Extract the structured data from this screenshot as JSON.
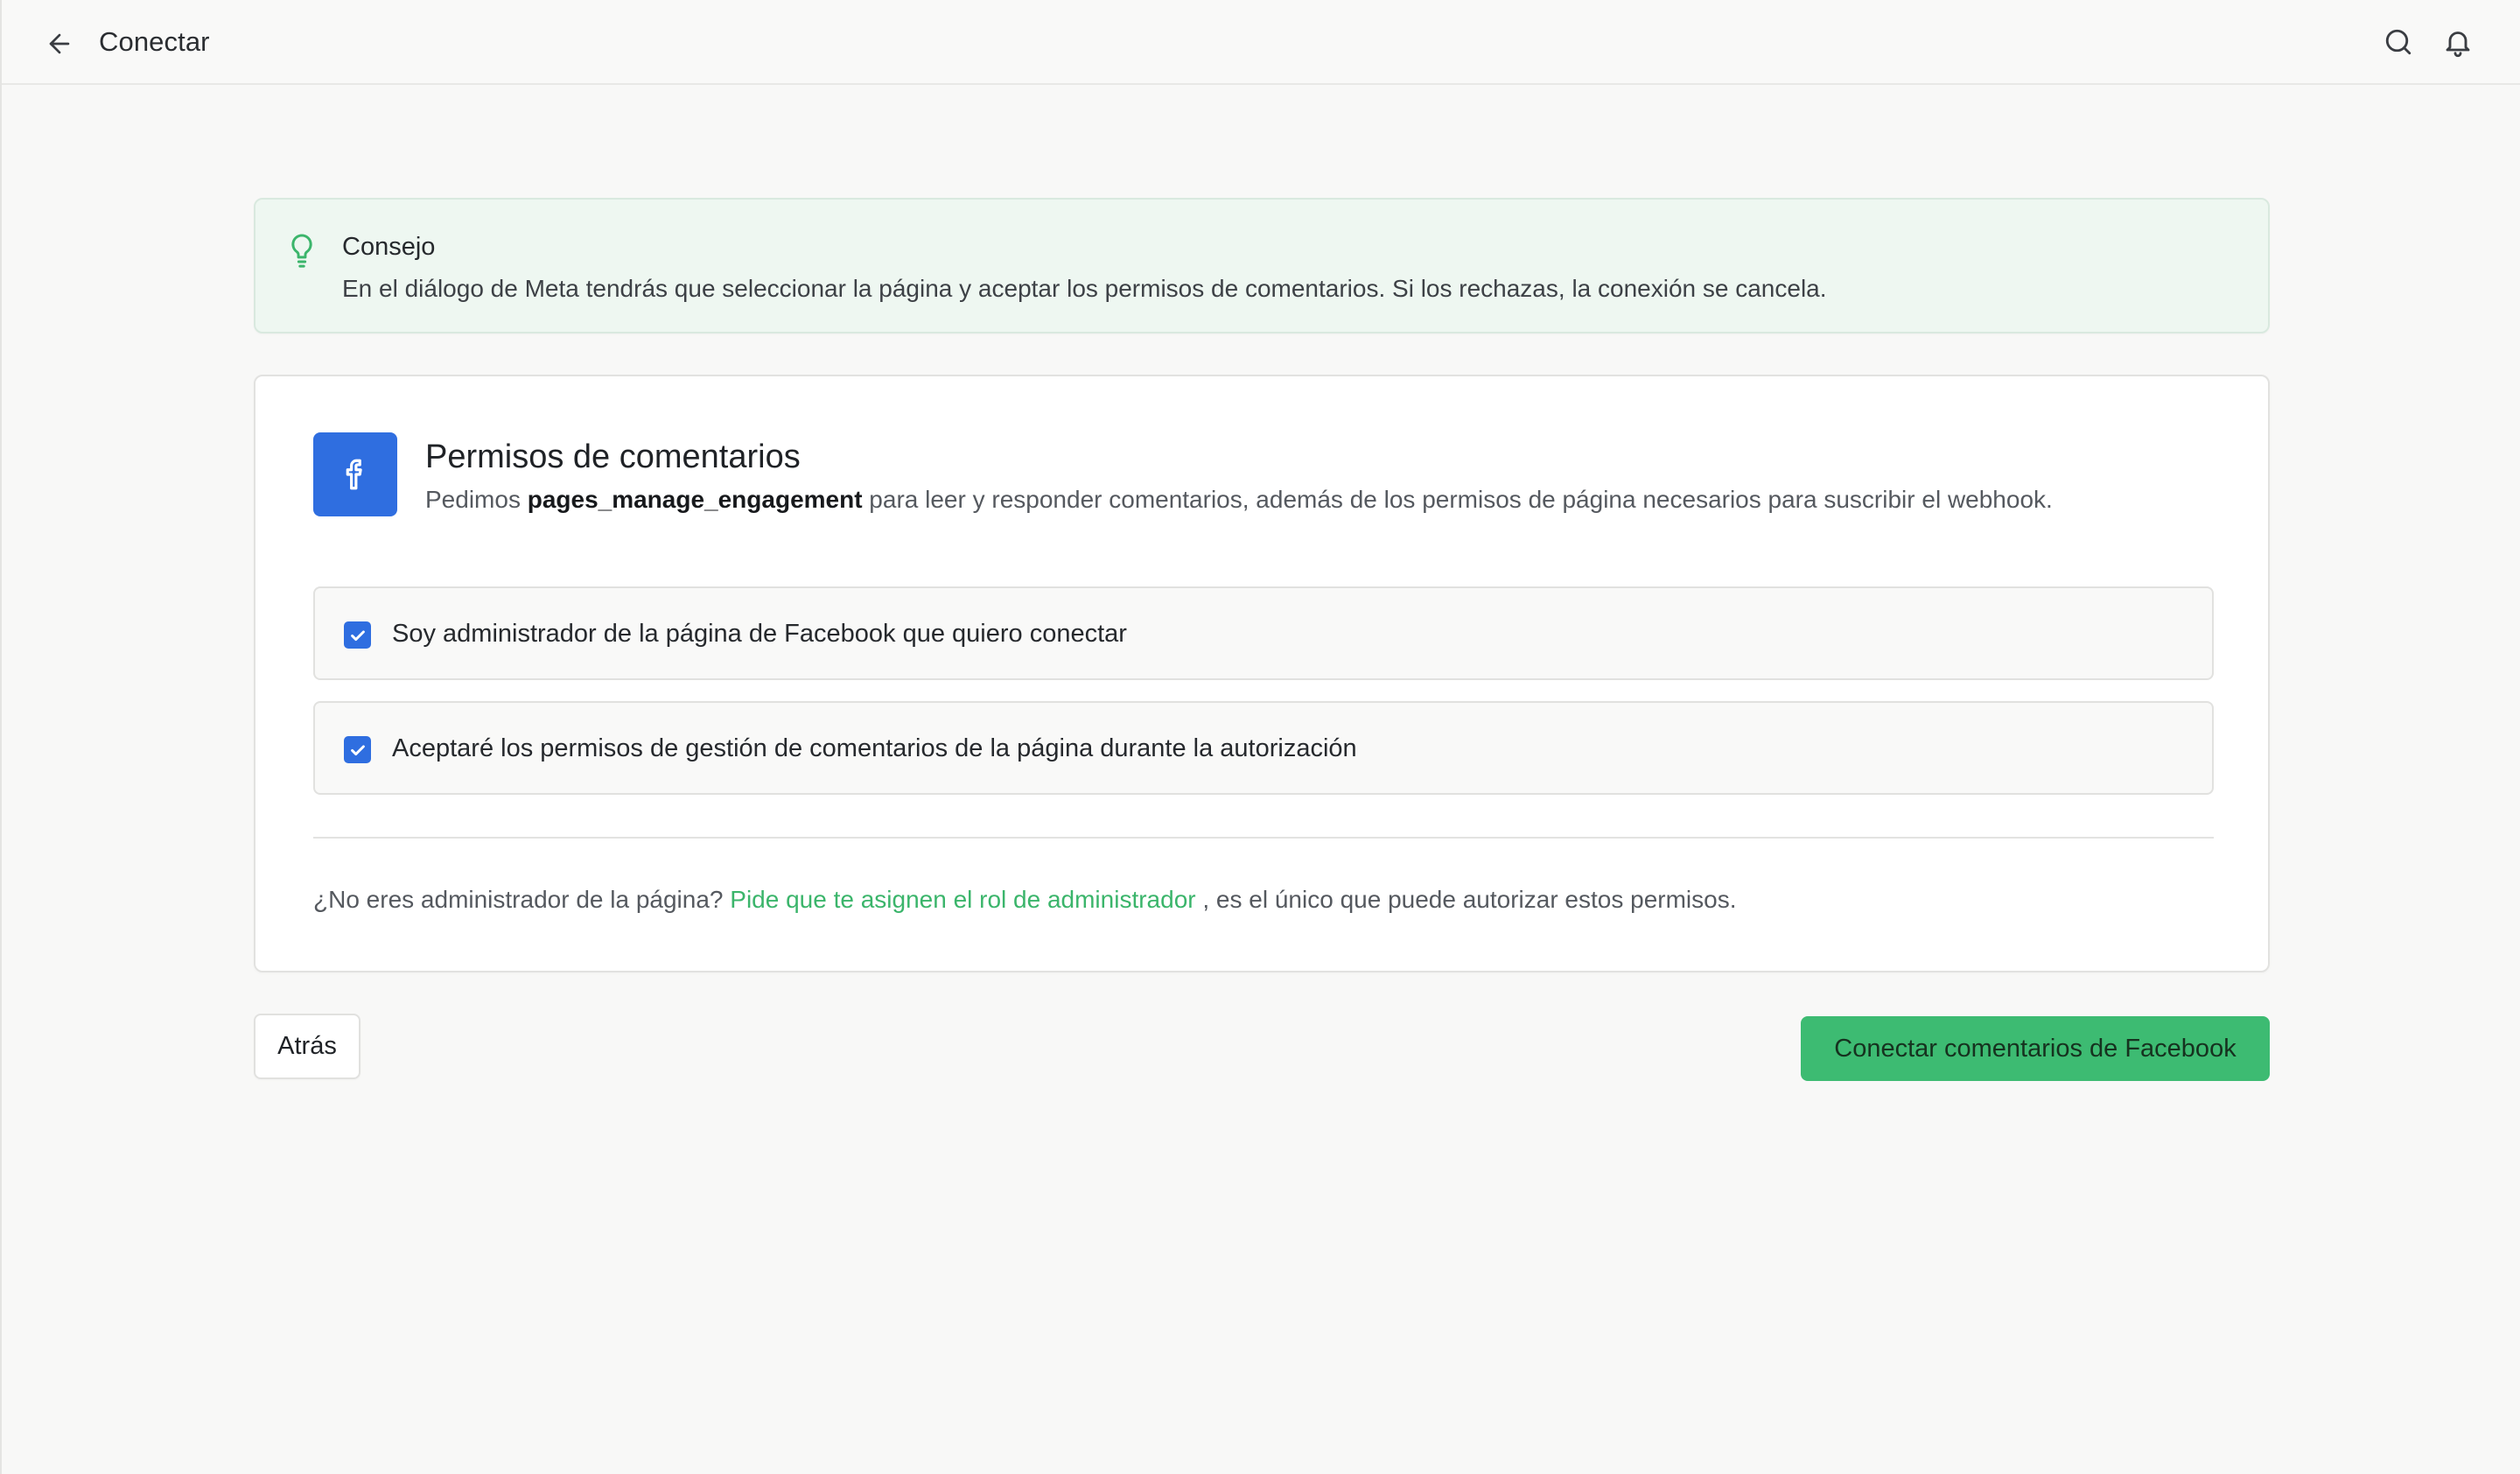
{
  "header": {
    "title": "Conectar"
  },
  "tip": {
    "title": "Consejo",
    "text": "En el diálogo de Meta tendrás que seleccionar la página y aceptar los permisos de comentarios. Si los rechazas, la conexión se cancela."
  },
  "permissions": {
    "title": "Permisos de comentarios",
    "desc_prefix": "Pedimos ",
    "desc_permission": "pages_manage_engagement",
    "desc_suffix": " para leer y responder comentarios, además de los permisos de página necesarios para suscribir el webhook.",
    "checks": [
      {
        "label": "Soy administrador de la página de Facebook que quiero conectar",
        "checked": true
      },
      {
        "label": "Aceptaré los permisos de gestión de comentarios de la página durante la autorización",
        "checked": true
      }
    ],
    "admin_note_prefix": "¿No eres administrador de la página? ",
    "admin_note_link": "Pide que te asignen el rol de administrador",
    "admin_note_suffix": " , es el único que puede autorizar estos permisos."
  },
  "footer": {
    "back_label": "Atrás",
    "connect_label": "Conectar comentarios de Facebook"
  },
  "colors": {
    "accent_green": "#3dbb72",
    "facebook_blue": "#2f6ee0",
    "tip_background": "#eef7f1"
  },
  "icons": {
    "back": "arrow-left-icon",
    "search": "search-icon",
    "notifications": "bell-icon",
    "tip": "lightbulb-icon",
    "facebook": "facebook-icon",
    "checkbox": "check-icon"
  }
}
